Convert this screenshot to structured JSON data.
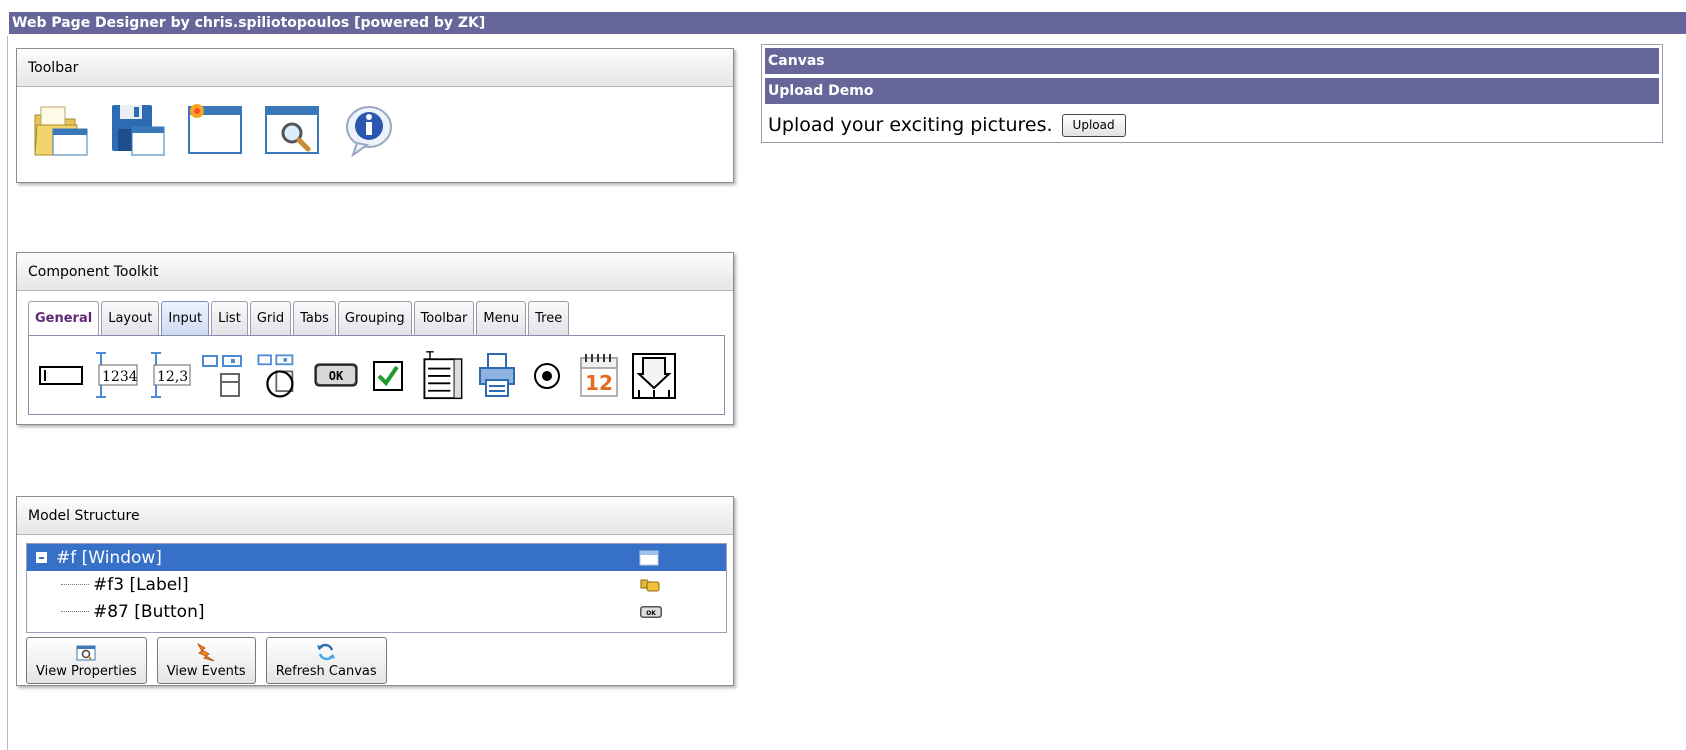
{
  "app": {
    "title": "Web Page Designer by chris.spiliotopoulos [powered by ZK]"
  },
  "toolbar_panel": {
    "title": "Toolbar",
    "icons": [
      "open-file-icon",
      "save-file-icon",
      "new-window-icon",
      "preview-icon",
      "info-icon"
    ]
  },
  "toolkit_panel": {
    "title": "Component Toolkit",
    "tabs": [
      {
        "label": "General",
        "state": "selected"
      },
      {
        "label": "Layout",
        "state": "normal"
      },
      {
        "label": "Input",
        "state": "hover"
      },
      {
        "label": "List",
        "state": "normal"
      },
      {
        "label": "Grid",
        "state": "normal"
      },
      {
        "label": "Tabs",
        "state": "normal"
      },
      {
        "label": "Grouping",
        "state": "normal"
      },
      {
        "label": "Toolbar",
        "state": "normal"
      },
      {
        "label": "Menu",
        "state": "normal"
      },
      {
        "label": "Tree",
        "state": "normal"
      }
    ],
    "components": {
      "intbox": "1234",
      "decimalbox": "12,3",
      "button": "OK",
      "calendar_day": "12"
    }
  },
  "model_panel": {
    "title": "Model Structure",
    "tree": [
      {
        "label": "#f [Window]",
        "selected": true
      },
      {
        "label": "#f3 [Label]",
        "selected": false
      },
      {
        "label": "#87 [Button]",
        "selected": false
      }
    ],
    "button_icon_text": "OK",
    "buttons": {
      "view_properties": "View Properties",
      "view_events": "View Events",
      "refresh_canvas": "Refresh Canvas"
    }
  },
  "canvas": {
    "title": "Canvas",
    "window_title": "Upload Demo",
    "text": "Upload your exciting pictures.",
    "upload_label": "Upload"
  },
  "colors": {
    "titlebar": "#66669a",
    "selection": "#3670c7",
    "selected_tab_text": "#5d2a78"
  }
}
